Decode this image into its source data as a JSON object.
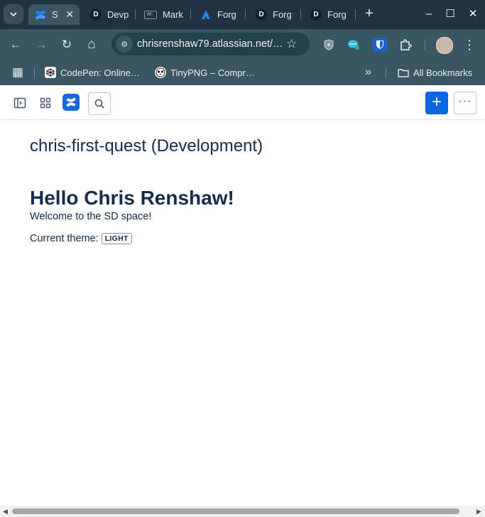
{
  "tabs": [
    {
      "label": "S",
      "icon": "confluence-icon",
      "active": true
    },
    {
      "label": "Devp",
      "icon": "d-logo-icon"
    },
    {
      "label": "Mark",
      "icon": "markdown-icon"
    },
    {
      "label": "Forg",
      "icon": "atlassian-icon"
    },
    {
      "label": "Forg",
      "icon": "d-logo-icon"
    },
    {
      "label": "Forg",
      "icon": "d-logo-icon"
    }
  ],
  "tab_close_glyph": "✕",
  "new_tab_glyph": "+",
  "window": {
    "minimize": "–",
    "maximize": "☐",
    "close": "✕"
  },
  "toolbar": {
    "back_glyph": "←",
    "forward_glyph": "→",
    "reload_glyph": "↻",
    "home_glyph": "⌂",
    "url": "chrisrenshaw79.atlassian.net/…",
    "site_info_glyph": "⚙",
    "star_glyph": "☆",
    "menu_glyph": "⋮"
  },
  "bookmarks": {
    "apps_glyph": "▦",
    "items": [
      {
        "label": "CodePen: Online…",
        "icon": "codepen-icon"
      },
      {
        "label": "TinyPNG – Compr…",
        "icon": "tinypng-panda-icon"
      }
    ],
    "overflow_glyph": "»",
    "all_bookmarks": "All Bookmarks",
    "folder_glyph": "🗀"
  },
  "appbar": {
    "sidebar_toggle_icon": "sidebar-toggle-icon",
    "app_switcher_icon": "app-grid-icon",
    "create_glyph": "+",
    "more_glyph": "···"
  },
  "content": {
    "page_title": "chris-first-quest (Development)",
    "heading": "Hello Chris Renshaw!",
    "welcome": "Welcome to the SD space!",
    "theme_label": "Current theme:",
    "theme_value": "LIGHT"
  },
  "scroll": {
    "left_glyph": "◀",
    "right_glyph": "▶"
  },
  "colors": {
    "tabstrip": "#1f3440",
    "toolbar": "#3a5663",
    "accent": "#0c66e4",
    "text": "#172b4d"
  }
}
